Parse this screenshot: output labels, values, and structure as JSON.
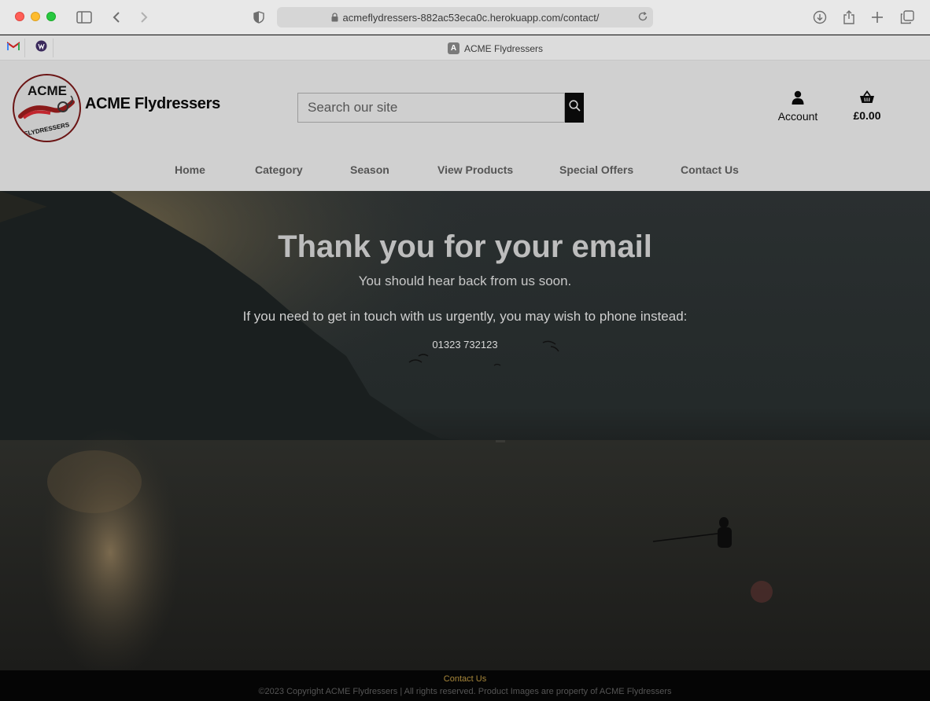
{
  "browser": {
    "url": "acmeflydressers-882ac53eca0c.herokuapp.com/contact/",
    "tab_title": "ACME Flydressers",
    "tab_favicon_letter": "A"
  },
  "header": {
    "logo_text_top": "ACME",
    "logo_text_bottom": "FLYDRESSERS",
    "brand": "ACME Flydressers",
    "search_placeholder": "Search our site",
    "account_label": "Account",
    "basket_total": "£0.00"
  },
  "nav": {
    "items": [
      "Home",
      "Category",
      "Season",
      "View Products",
      "Special Offers",
      "Contact Us"
    ]
  },
  "hero": {
    "title": "Thank you for your email",
    "subtitle": "You should hear back from us soon.",
    "urgent_text": "If you need to get in touch with us urgently, you may wish to phone instead:",
    "phone": "01323 732123"
  },
  "footer": {
    "link": "Contact Us",
    "copyright": "©2023 Copyright ACME Flydressers | All rights reserved. Product Images are property of ACME Flydressers"
  },
  "colors": {
    "brand_red": "#6b1515",
    "footer_link": "#a8873a"
  }
}
